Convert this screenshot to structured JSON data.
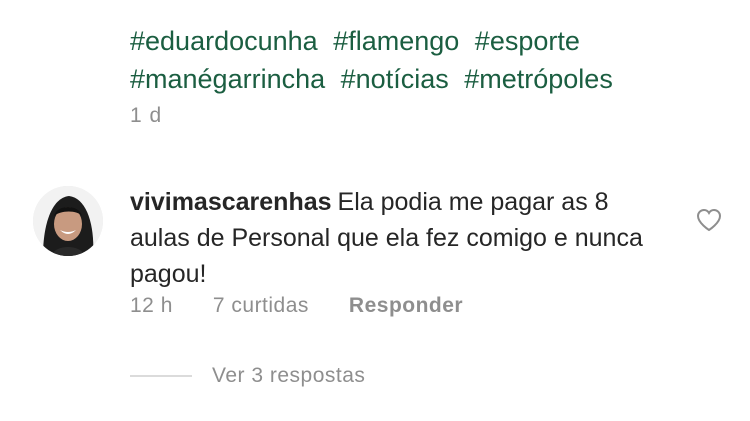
{
  "post": {
    "hashtags": [
      "#eduardocunha",
      "#flamengo",
      "#esporte",
      "#manégarrincha",
      "#notícias",
      "#metrópoles"
    ],
    "time": "1 d"
  },
  "comment": {
    "username": "vivimascarenhas",
    "text": "Ela podia me pagar as 8 aulas de Personal que ela fez comigo e nunca pagou!",
    "time": "12 h",
    "likes": "7 curtidas",
    "reply_label": "Responder",
    "view_replies": "Ver 3 respostas",
    "like_icon": "heart-outline-icon"
  }
}
